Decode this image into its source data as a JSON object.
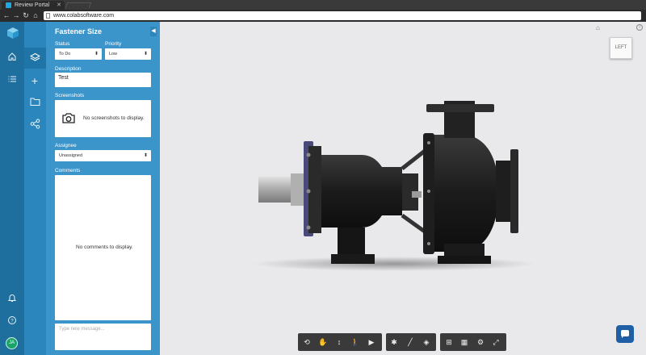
{
  "browser": {
    "tab_title": "Review Portal",
    "url": "www.colabsoftware.com"
  },
  "panel": {
    "title": "Fastener Size",
    "status_label": "Status",
    "status_value": "To Do",
    "priority_label": "Priority",
    "priority_value": "Low",
    "description_label": "Description",
    "description_value": "Test",
    "screenshots_label": "Screenshots",
    "screenshots_empty": "No screenshots to display.",
    "assignee_label": "Assignee",
    "assignee_value": "Unassigned",
    "comments_label": "Comments",
    "comments_empty": "No comments to display.",
    "message_placeholder": "Type new message..."
  },
  "viewer": {
    "viewcube_label": "LEFT"
  },
  "user": {
    "initials": "JA"
  }
}
